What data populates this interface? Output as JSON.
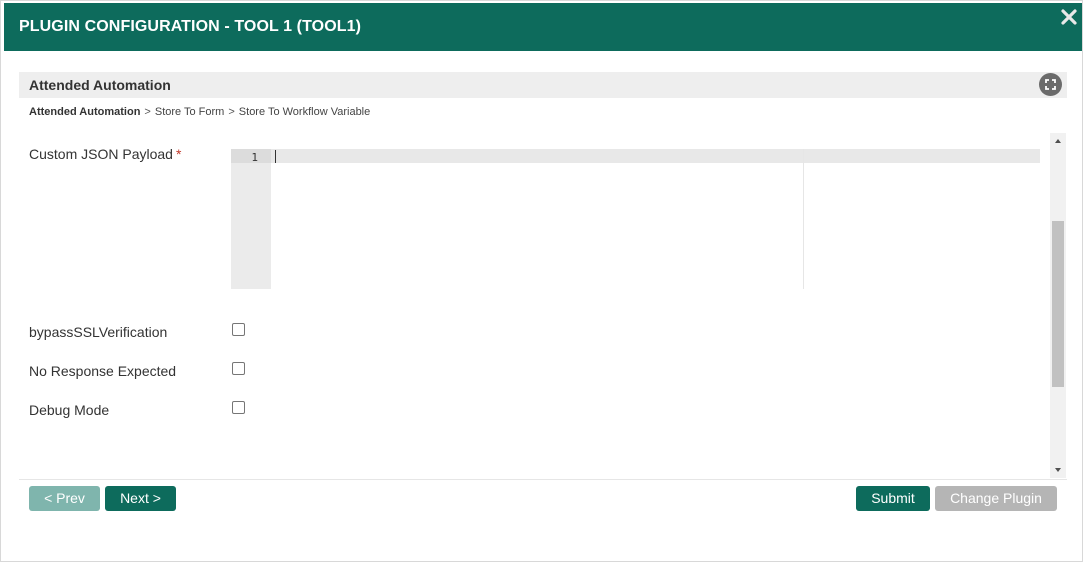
{
  "dialog": {
    "title": "PLUGIN CONFIGURATION - TOOL 1 (TOOL1)",
    "close_icon": "close-icon"
  },
  "panel": {
    "title": "Attended Automation",
    "expand_icon": "expand-icon"
  },
  "breadcrumb": {
    "items": [
      "Attended Automation",
      "Store To Form",
      "Store To Workflow Variable"
    ],
    "separator": ">"
  },
  "form": {
    "custom_json_label": "Custom JSON Payload",
    "required_marker": "*",
    "editor": {
      "line_numbers": [
        "1"
      ],
      "value": ""
    },
    "checkboxes": [
      {
        "label": "bypassSSLVerification",
        "checked": false
      },
      {
        "label": "No Response Expected",
        "checked": false
      },
      {
        "label": "Debug Mode",
        "checked": false
      }
    ]
  },
  "footer": {
    "prev_label": "< Prev",
    "next_label": "Next >",
    "submit_label": "Submit",
    "change_plugin_label": "Change Plugin"
  },
  "colors": {
    "brand": "#0d6b5c",
    "brand_disabled": "#7fb5ad",
    "button_disabled": "#b5b5b5",
    "required": "#c0392b"
  }
}
